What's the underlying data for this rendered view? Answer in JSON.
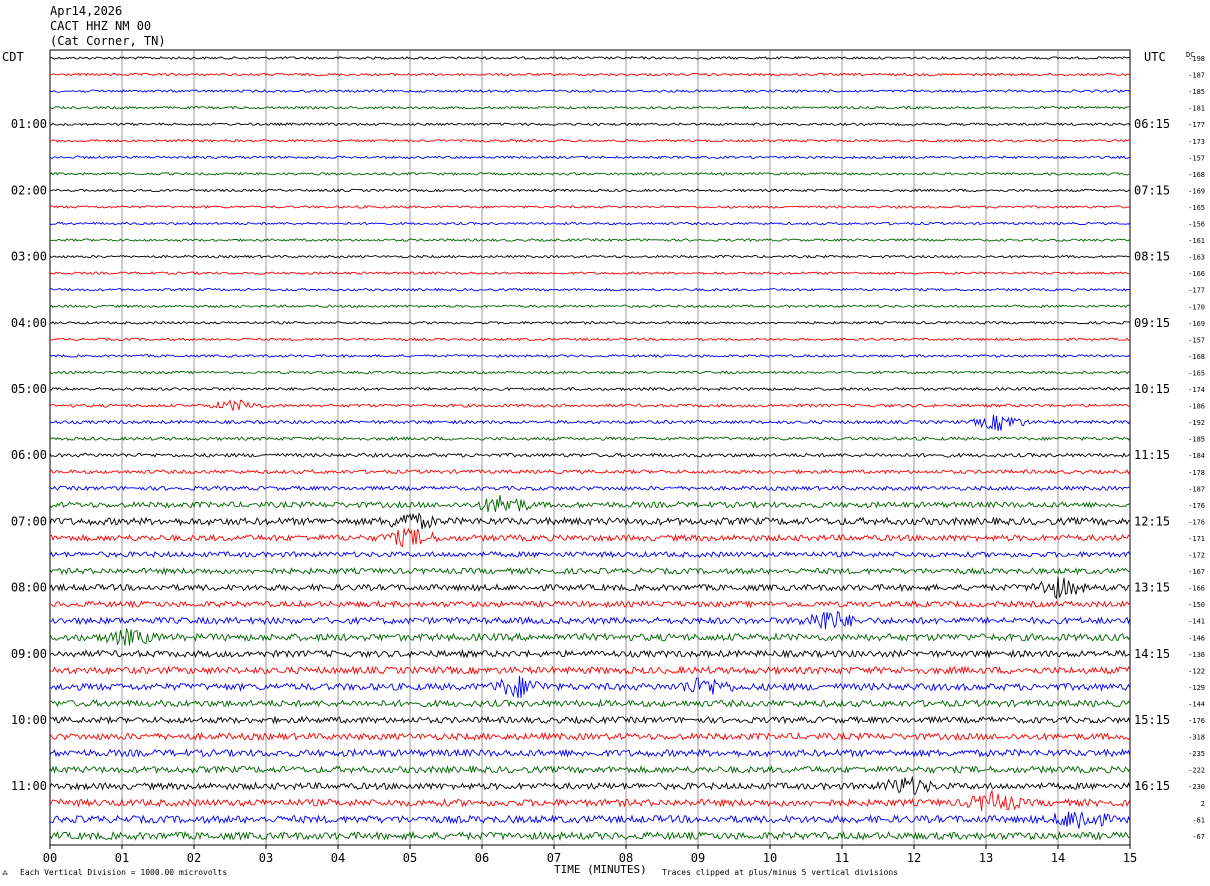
{
  "header": {
    "date": "Apr14,2026",
    "station": "CACT HHZ NM 00",
    "location": "(Cat Corner, TN)"
  },
  "labels": {
    "left_zone": "CDT",
    "right_zone": "UTC",
    "dc_label": "DC",
    "xlabel": "TIME (MINUTES)",
    "scale_note": "Each Vertical Division = 1000.00 microvolts",
    "clip_note": "Traces clipped at plus/minus 5 vertical divisions"
  },
  "chart_data": {
    "type": "line",
    "title": "CACT HHZ NM 00 (Cat Corner, TN)",
    "xlabel": "TIME (MINUTES)",
    "ylabel": "",
    "xlim": [
      0,
      15
    ],
    "x_ticks": [
      "00",
      "01",
      "02",
      "03",
      "04",
      "05",
      "06",
      "07",
      "08",
      "09",
      "10",
      "11",
      "12",
      "13",
      "14",
      "15"
    ],
    "trace_colors": [
      "#000000",
      "#ff0000",
      "#0000ff",
      "#006400"
    ],
    "left_time_labels": [
      "01:00",
      "02:00",
      "03:00",
      "04:00",
      "05:00",
      "06:00",
      "07:00",
      "08:00",
      "09:00",
      "10:00",
      "11:00"
    ],
    "right_time_labels": [
      "06:15",
      "07:15",
      "08:15",
      "09:15",
      "10:15",
      "11:15",
      "12:15",
      "13:15",
      "14:15",
      "15:15",
      "16:15"
    ],
    "dc_offsets": [
      "-198",
      "-187",
      "-185",
      "-181",
      "-177",
      "-173",
      "-157",
      "-168",
      "-169",
      "-165",
      "-156",
      "-161",
      "-163",
      "-166",
      "-177",
      "-170",
      "-169",
      "-157",
      "-168",
      "-165",
      "-174",
      "-186",
      "-192",
      "-185",
      "-184",
      "-178",
      "-187",
      "-176",
      "-176",
      "-171",
      "-172",
      "-167",
      "-166",
      "-150",
      "-141",
      "-146",
      "-136",
      "-122",
      "-129",
      "-144",
      "-176",
      "-318",
      "-235",
      "-222",
      "-230",
      "2",
      "-61",
      "-67"
    ],
    "trace_amplitude": [
      1.2,
      1.2,
      1.2,
      1.2,
      1.2,
      1.2,
      1.2,
      1.2,
      1.2,
      1.2,
      1.2,
      1.2,
      1.2,
      1.2,
      1.2,
      1.2,
      1.2,
      1.2,
      1.2,
      1.2,
      1.4,
      1.5,
      1.6,
      1.6,
      1.8,
      1.8,
      2.0,
      2.8,
      3.5,
      3.0,
      2.6,
      2.8,
      3.0,
      2.8,
      3.2,
      3.5,
      3.2,
      3.4,
      3.4,
      3.2,
      3.0,
      3.2,
      3.4,
      3.2,
      3.2,
      3.4,
      3.6,
      3.6
    ],
    "events": [
      {
        "trace": 21,
        "minute": 2.6,
        "size": 5
      },
      {
        "trace": 22,
        "minute": 13.2,
        "size": 8
      },
      {
        "trace": 27,
        "minute": 6.3,
        "size": 9
      },
      {
        "trace": 28,
        "minute": 5.0,
        "size": 7
      },
      {
        "trace": 29,
        "minute": 5.0,
        "size": 8
      },
      {
        "trace": 32,
        "minute": 14.0,
        "size": 9
      },
      {
        "trace": 34,
        "minute": 10.8,
        "size": 10
      },
      {
        "trace": 35,
        "minute": 1.1,
        "size": 6
      },
      {
        "trace": 38,
        "minute": 6.5,
        "size": 9
      },
      {
        "trace": 38,
        "minute": 9.1,
        "size": 8
      },
      {
        "trace": 44,
        "minute": 11.9,
        "size": 8
      },
      {
        "trace": 45,
        "minute": 13.1,
        "size": 9
      },
      {
        "trace": 46,
        "minute": 14.3,
        "size": 10
      }
    ]
  }
}
